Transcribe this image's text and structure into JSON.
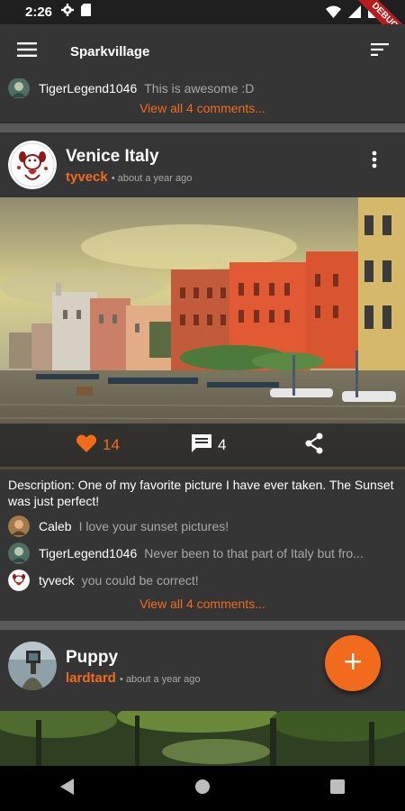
{
  "status": {
    "time": "2:26",
    "debug_label": "DEBUG"
  },
  "appbar": {
    "title": "Sparkvillage"
  },
  "top_card": {
    "comment": {
      "user": "TigerLegend1046",
      "text": "This is awesome :D"
    },
    "view_all": "View all 4 comments..."
  },
  "post1": {
    "title": "Venice Italy",
    "author": "tyveck",
    "time": "• about a year ago",
    "likes": "14",
    "comments_count": "4",
    "description": "Description: One of my favorite picture I have ever taken. The Sunset was just perfect!",
    "comments": [
      {
        "user": "Caleb",
        "text": "I love your sunset pictures!"
      },
      {
        "user": "TigerLegend1046",
        "text": "Never been to that part of Italy but fro..."
      },
      {
        "user": "tyveck",
        "text": "you could be correct!"
      }
    ],
    "view_all": "View all 4 comments..."
  },
  "post2": {
    "title": "Puppy",
    "author": "lardtard",
    "time": "• about a year ago"
  },
  "colors": {
    "accent": "#f26b1d",
    "background": "#2f2f2f",
    "card": "#353535"
  }
}
